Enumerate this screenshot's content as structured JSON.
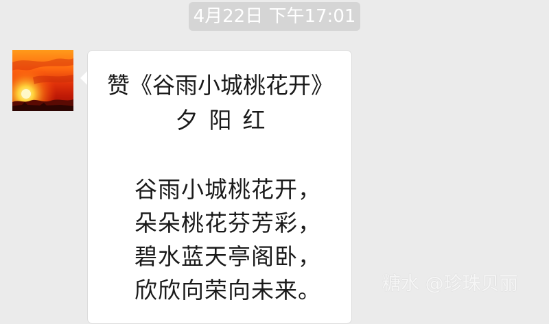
{
  "timestamp": "4月22日 下午17:01",
  "message": {
    "title": "赞《谷雨小城桃花开》",
    "author": "夕阳红",
    "poem": [
      "谷雨小城桃花开，",
      "朵朵桃花芬芳彩，",
      "碧水蓝天亭阁卧，",
      "欣欣向荣向未来。"
    ]
  },
  "sender": {
    "avatar": "sunset-avatar"
  },
  "watermark": "糖水 @珍珠贝丽",
  "colors": {
    "background": "#ebebeb",
    "bubble": "#ffffff",
    "timestamp_bg": "#d5d5d5",
    "text": "#1a1a1a"
  }
}
